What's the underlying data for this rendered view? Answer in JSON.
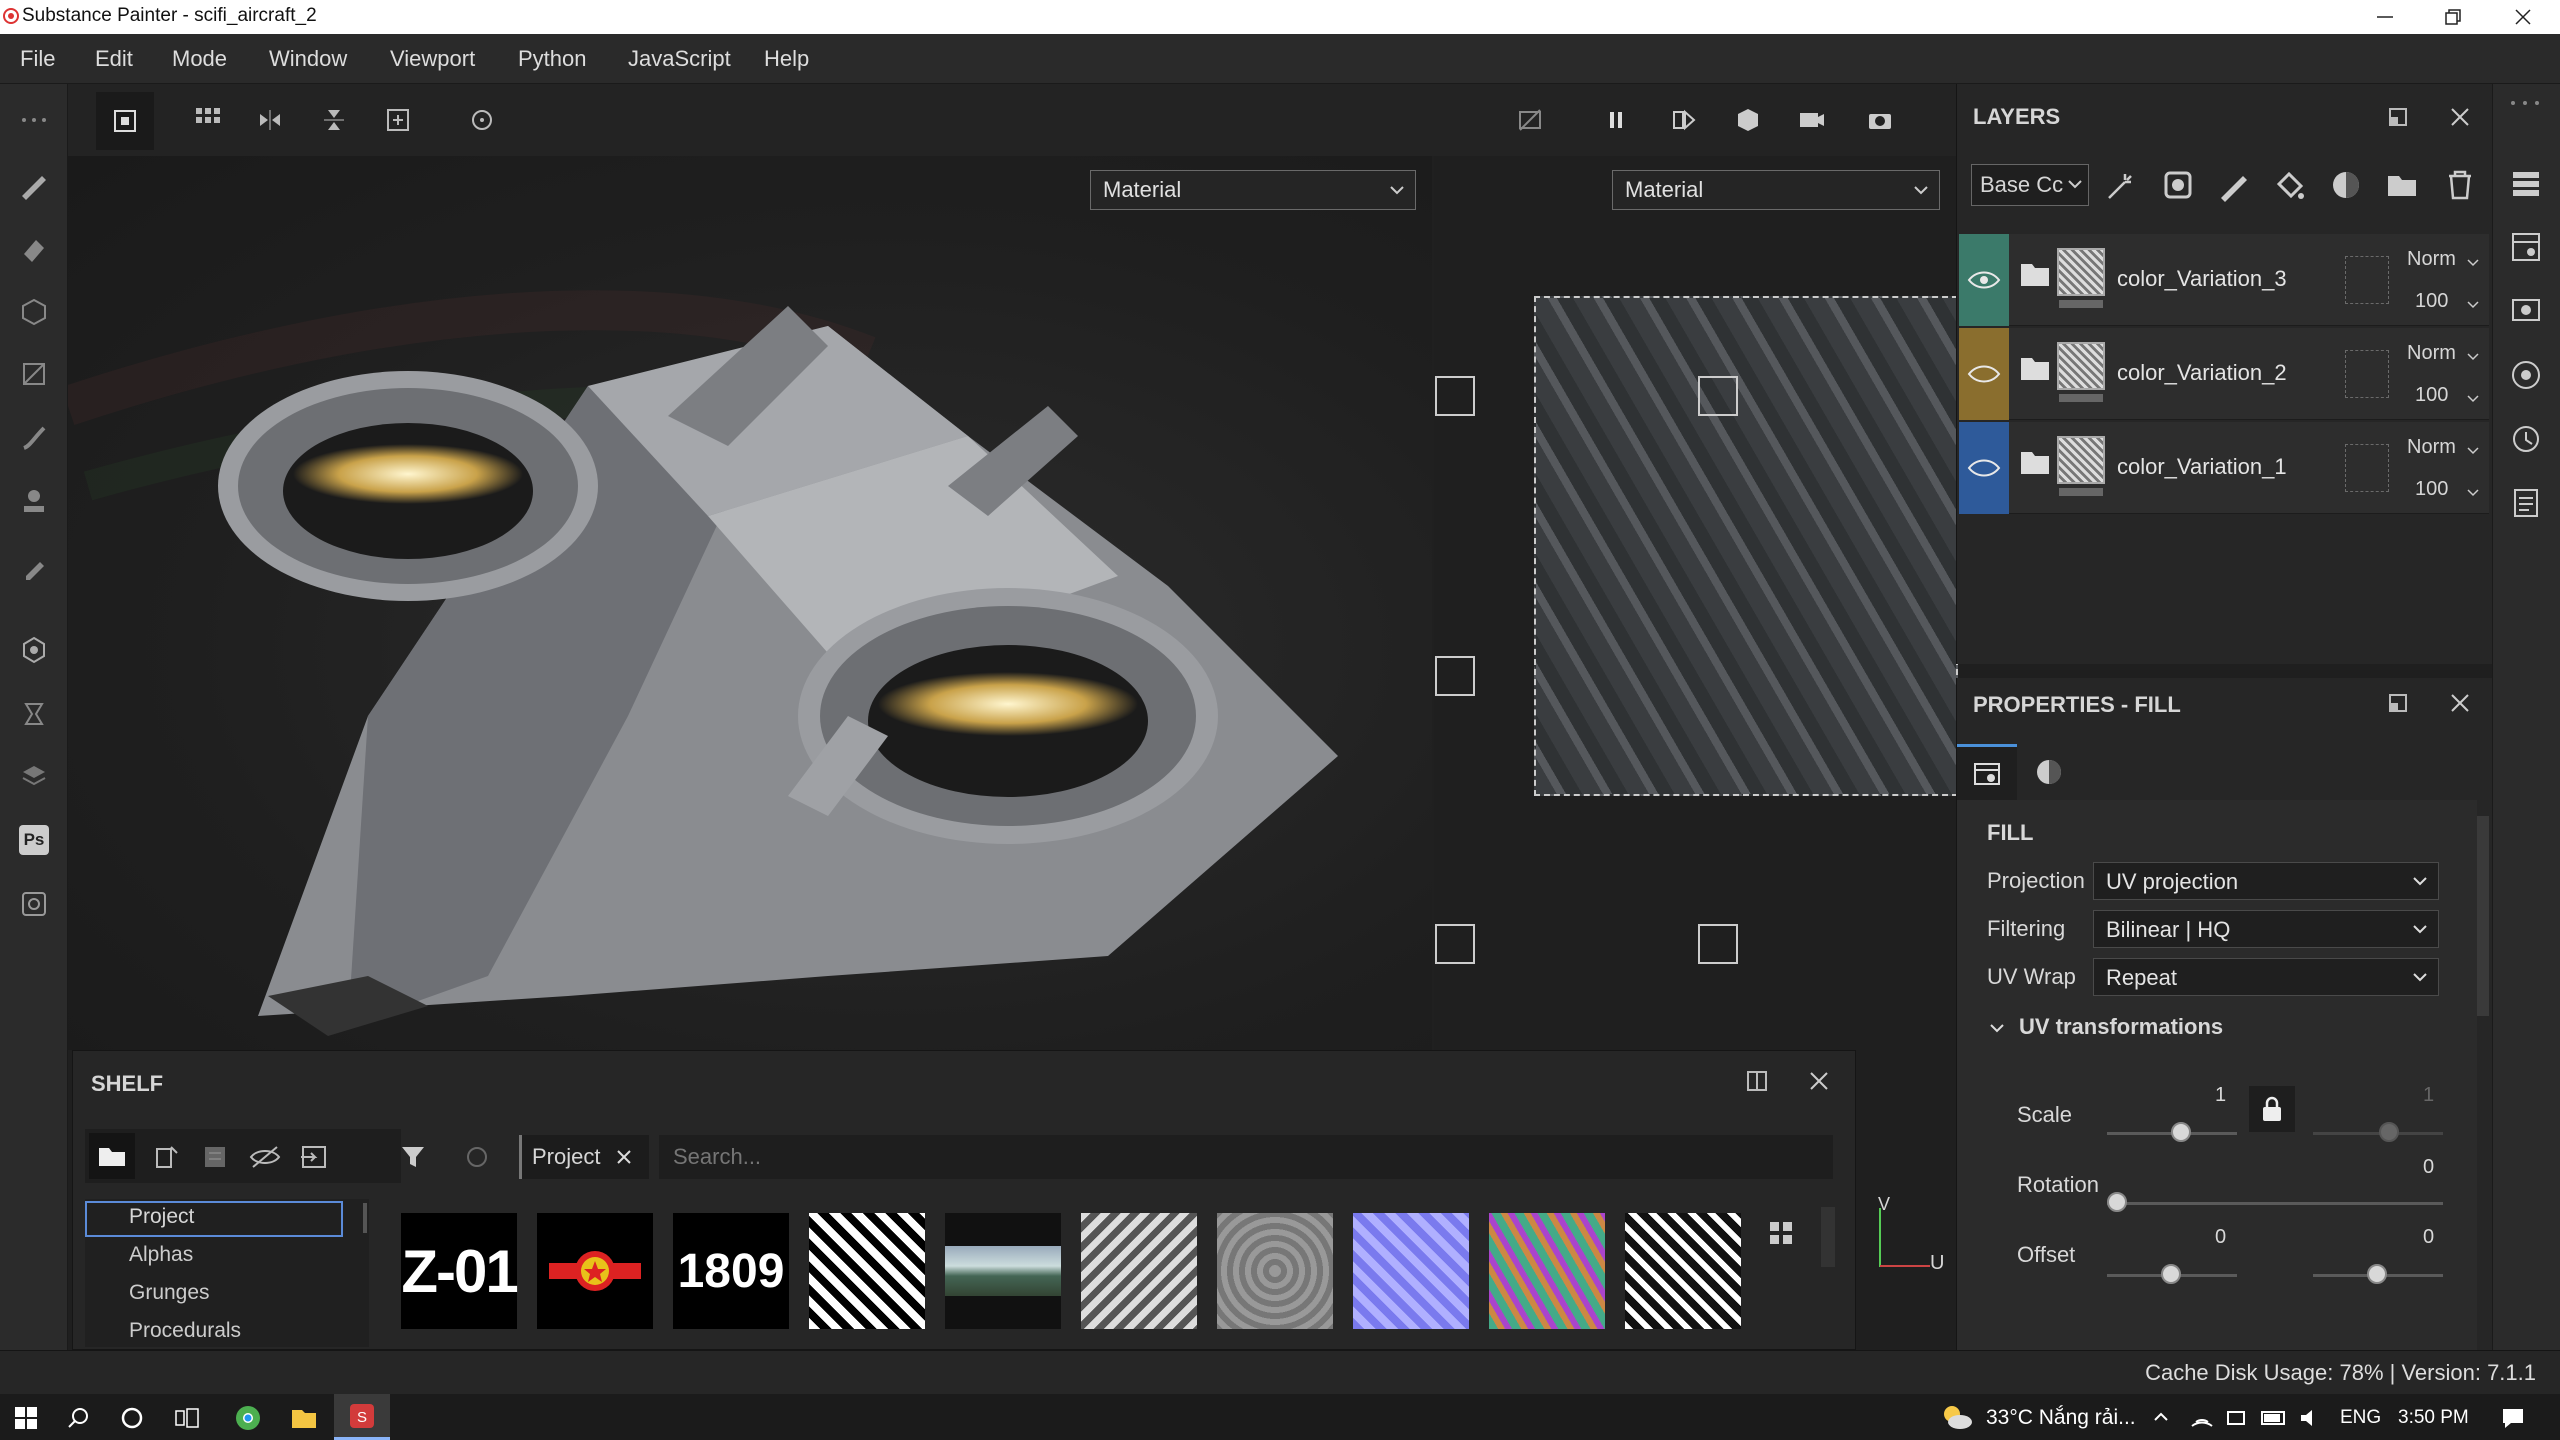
{
  "app": {
    "title": "Substance Painter - scifi_aircraft_2"
  },
  "menu": [
    "File",
    "Edit",
    "Mode",
    "Window",
    "Viewport",
    "Python",
    "JavaScript",
    "Help"
  ],
  "viewport": {
    "left_dropdown": "Material",
    "right_dropdown": "Material",
    "axis_v": "V",
    "axis_u": "U"
  },
  "layers": {
    "title": "LAYERS",
    "channel_dropdown": "Base Cc",
    "items": [
      {
        "name": "color_Variation_3",
        "blend": "Norm",
        "opacity": "100",
        "color": "#3b7a6a"
      },
      {
        "name": "color_Variation_2",
        "blend": "Norm",
        "opacity": "100",
        "color": "#8a6e2e"
      },
      {
        "name": "color_Variation_1",
        "blend": "Norm",
        "opacity": "100",
        "color": "#2e5a9a"
      }
    ]
  },
  "properties": {
    "title": "PROPERTIES - FILL",
    "section": "FILL",
    "projection_label": "Projection",
    "projection_value": "UV projection",
    "filtering_label": "Filtering",
    "filtering_value": "Bilinear | HQ",
    "uvwrap_label": "UV Wrap",
    "uvwrap_value": "Repeat",
    "uvtrans_label": "UV transformations",
    "scale_label": "Scale",
    "scale_u": "1",
    "scale_v": "1",
    "rotation_label": "Rotation",
    "rotation_value": "0",
    "offset_label": "Offset",
    "offset_u": "0",
    "offset_v": "0"
  },
  "shelf": {
    "title": "SHELF",
    "tag": "Project",
    "search_placeholder": "Search...",
    "categories": [
      "Project",
      "Alphas",
      "Grunges",
      "Procedurals"
    ],
    "thumb_texts": [
      "Z-01",
      "",
      "1809"
    ]
  },
  "status": {
    "text": "Cache Disk Usage: 78% | Version: 7.1.1"
  },
  "taskbar": {
    "weather": "33°C  Nắng rải...",
    "lang": "ENG",
    "time": "3:50 PM"
  }
}
